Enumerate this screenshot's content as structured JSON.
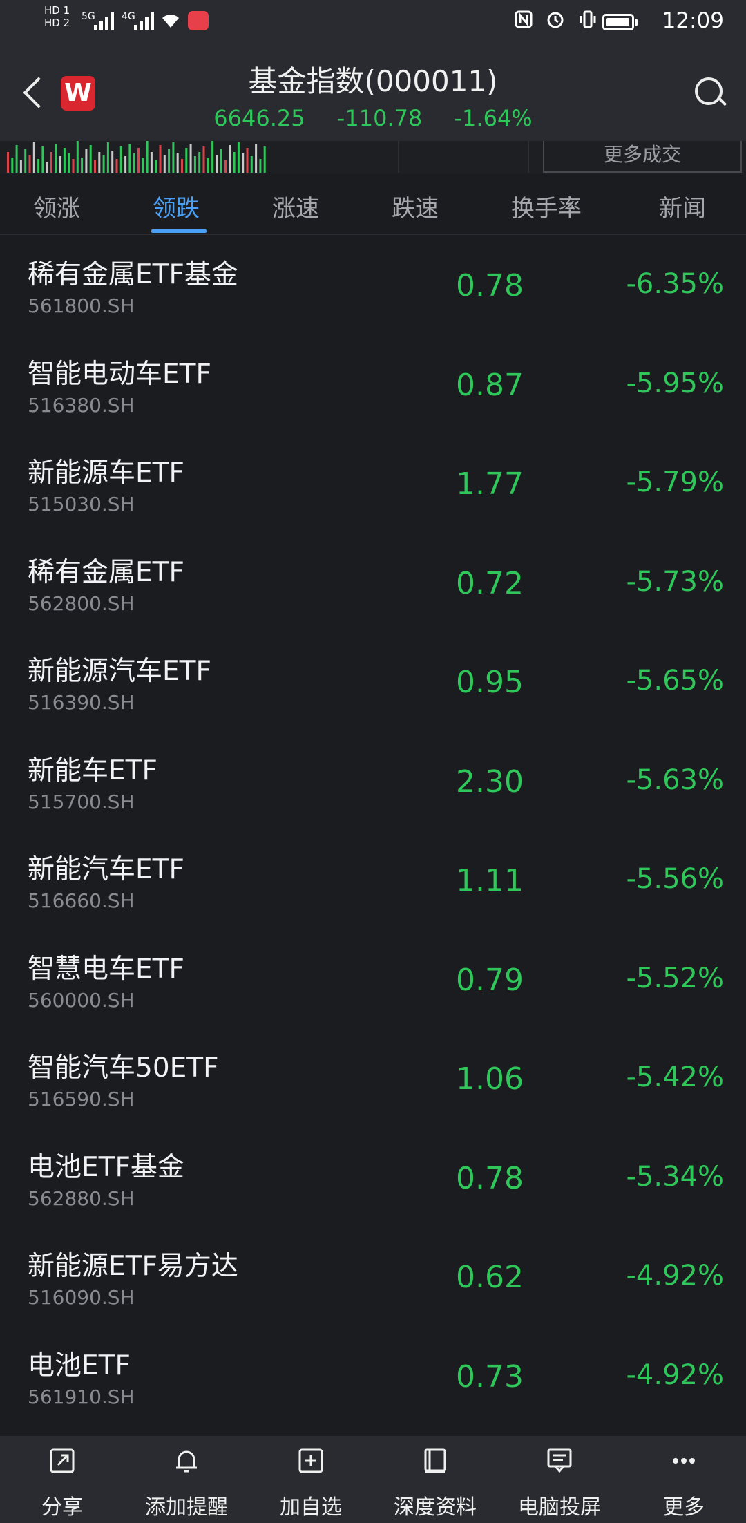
{
  "status_bar": {
    "sim1": "HD 1",
    "sim2": "HD 2",
    "net1": "5G",
    "net2": "4G",
    "time": "12:09"
  },
  "header": {
    "logo": "W",
    "title": "基金指数(000011)",
    "price": "6646.25",
    "change": "-110.78",
    "change_pct": "-1.64%"
  },
  "strip": {
    "more_trades": "更多成交"
  },
  "tabs": [
    {
      "label": "领涨"
    },
    {
      "label": "领跌"
    },
    {
      "label": "涨速"
    },
    {
      "label": "跌速"
    },
    {
      "label": "换手率"
    },
    {
      "label": "新闻"
    }
  ],
  "active_tab": "领跌",
  "rows": [
    {
      "name": "稀有金属ETF基金",
      "code": "561800.SH",
      "price": "0.78",
      "change": "-6.35%"
    },
    {
      "name": "智能电动车ETF",
      "code": "516380.SH",
      "price": "0.87",
      "change": "-5.95%"
    },
    {
      "name": "新能源车ETF",
      "code": "515030.SH",
      "price": "1.77",
      "change": "-5.79%"
    },
    {
      "name": "稀有金属ETF",
      "code": "562800.SH",
      "price": "0.72",
      "change": "-5.73%"
    },
    {
      "name": "新能源汽车ETF",
      "code": "516390.SH",
      "price": "0.95",
      "change": "-5.65%"
    },
    {
      "name": "新能车ETF",
      "code": "515700.SH",
      "price": "2.30",
      "change": "-5.63%"
    },
    {
      "name": "新能汽车ETF",
      "code": "516660.SH",
      "price": "1.11",
      "change": "-5.56%"
    },
    {
      "name": "智慧电车ETF",
      "code": "560000.SH",
      "price": "0.79",
      "change": "-5.52%"
    },
    {
      "name": "智能汽车50ETF",
      "code": "516590.SH",
      "price": "1.06",
      "change": "-5.42%"
    },
    {
      "name": "电池ETF基金",
      "code": "562880.SH",
      "price": "0.78",
      "change": "-5.34%"
    },
    {
      "name": "新能源ETF易方达",
      "code": "516090.SH",
      "price": "0.62",
      "change": "-4.92%"
    },
    {
      "name": "电池ETF",
      "code": "561910.SH",
      "price": "0.73",
      "change": "-4.92%"
    }
  ],
  "bottom_bar": [
    {
      "label": "分享",
      "icon": "share-icon"
    },
    {
      "label": "添加提醒",
      "icon": "bell-icon"
    },
    {
      "label": "加自选",
      "icon": "add-watchlist-icon"
    },
    {
      "label": "深度资料",
      "icon": "book-icon"
    },
    {
      "label": "电脑投屏",
      "icon": "screen-cast-icon"
    },
    {
      "label": "更多",
      "icon": "more-dots-icon"
    }
  ],
  "colors": {
    "down": "#2fc65a",
    "accent": "#4aa0f5",
    "background": "#1b1c20",
    "bar": "#2a2b30"
  }
}
